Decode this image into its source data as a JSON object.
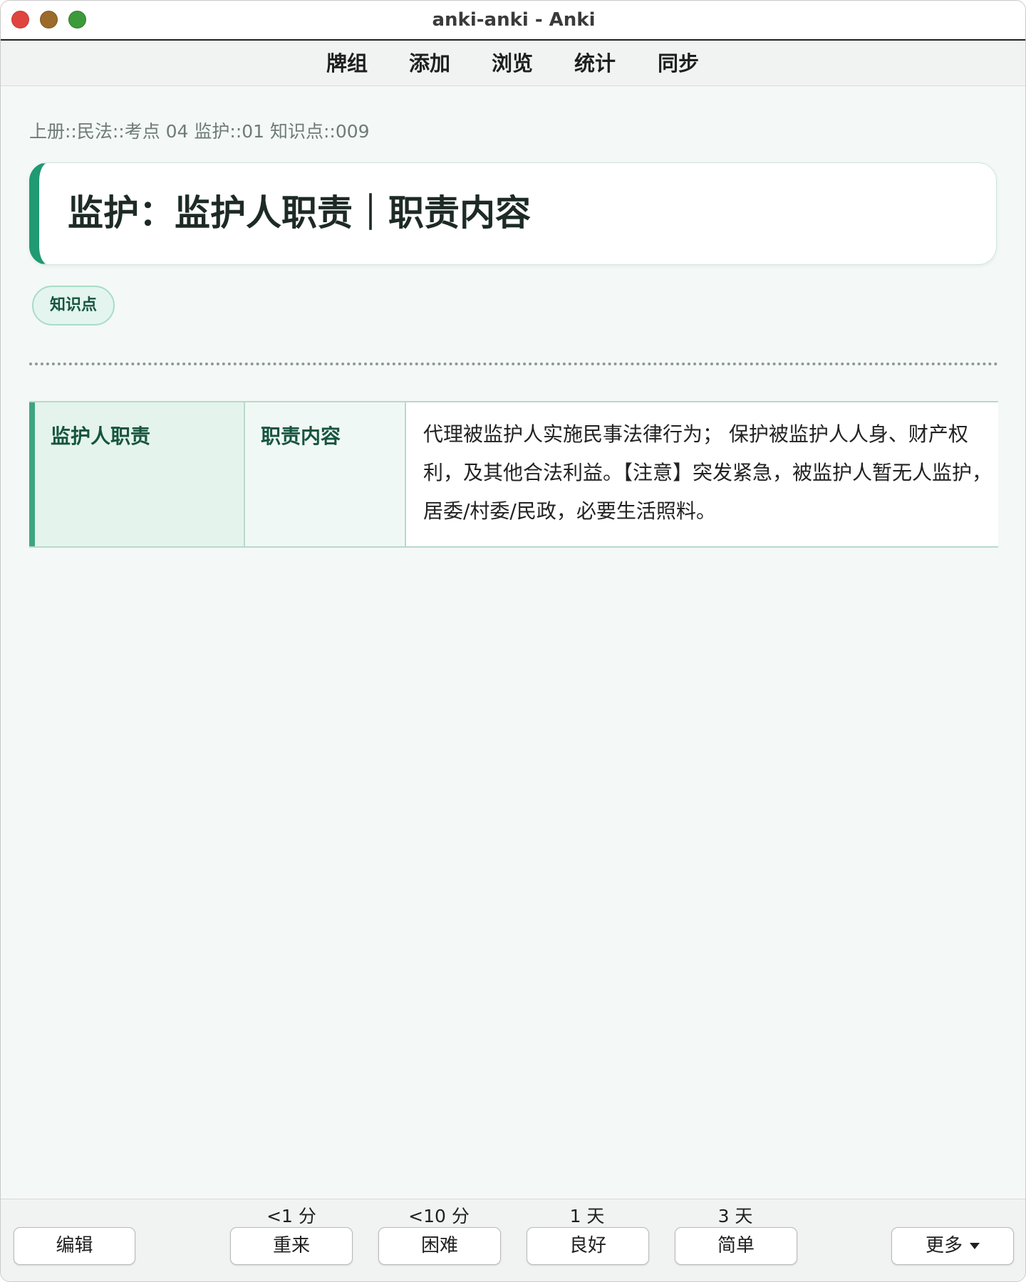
{
  "window": {
    "title": "anki-anki - Anki"
  },
  "toolbar": {
    "items": [
      "牌组",
      "添加",
      "浏览",
      "统计",
      "同步"
    ]
  },
  "card": {
    "breadcrumb": "上册::民法::考点 04 监护::01 知识点::009",
    "title": "监护：监护人职责｜职责内容",
    "tag": "知识点",
    "table": {
      "col1": "监护人职责",
      "col2": "职责内容",
      "col3": "代理被监护人实施民事法律行为； 保护被监护人人身、财产权利，及其他合法利益。【注意】突发紧急，被监护人暂无人监护，居委/村委/民政，必要生活照料。"
    }
  },
  "answer_bar": {
    "edit_label": "编辑",
    "more_label": "更多",
    "buttons": [
      {
        "interval": "<1 分",
        "label": "重来"
      },
      {
        "interval": "<10 分",
        "label": "困难"
      },
      {
        "interval": "1 天",
        "label": "良好"
      },
      {
        "interval": "3 天",
        "label": "简单"
      }
    ]
  },
  "colors": {
    "accent": "#1f9a72",
    "accent_dark": "#17553f",
    "page_bg": "#f4f8f7"
  }
}
